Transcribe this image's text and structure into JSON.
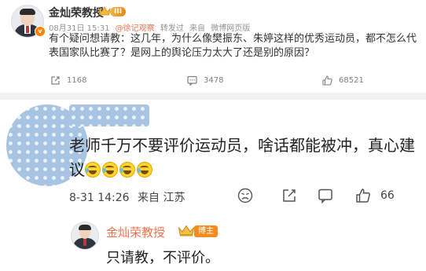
{
  "post": {
    "author": "金灿荣教授",
    "level": "III",
    "date": "08月31日 15:31",
    "repost_from": "@徐记观察",
    "repost_label": "转发过",
    "source_prefix": "来自",
    "source": "微博网页版",
    "text": "有个疑问想请教：这几年，为什么像樊振东、朱婷这样的优秀运动员，都不怎么代表国家队比赛了？是网上的舆论压力太大了还是别的原因？",
    "reposts": "1168",
    "comments": "3478",
    "likes": "68521"
  },
  "comment": {
    "text": "老师千万不要评价运动员，啥话都能被冲，真心建议",
    "emojis": [
      "laugh-cry",
      "laugh-cry",
      "laugh-cry",
      "laugh-cry"
    ],
    "time": "8-31 14:26",
    "source": "来自 江苏",
    "like_count": "66"
  },
  "reply": {
    "author": "金灿荣教授",
    "badge": "博主",
    "text": "只请教，不评价。"
  },
  "colors": {
    "link": "#eb7350",
    "badge_orange": "#f28c1f",
    "divider": "#f2f2f2"
  }
}
